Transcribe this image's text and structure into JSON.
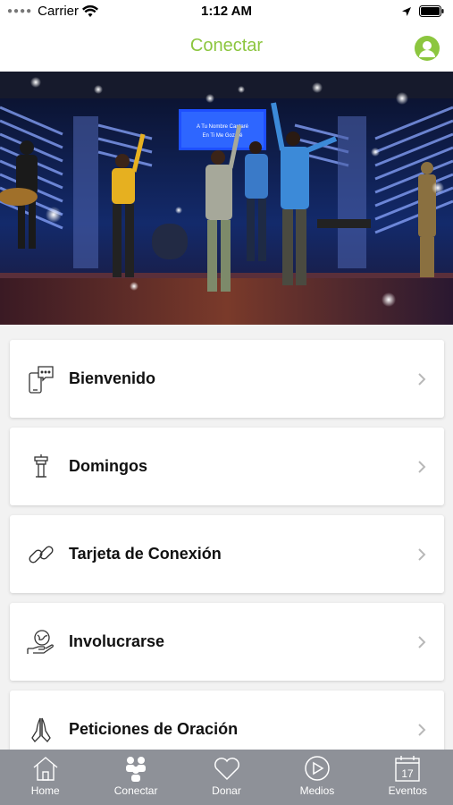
{
  "status": {
    "carrier": "Carrier",
    "time": "1:12 AM"
  },
  "nav": {
    "title": "Conectar"
  },
  "hero": {
    "banner_line1": "A Tu Nombre Cantaré",
    "banner_line2": "En Ti Me Gozaré"
  },
  "menu": [
    {
      "label": "Bienvenido",
      "icon": "phone-chat-icon"
    },
    {
      "label": "Domingos",
      "icon": "podium-icon"
    },
    {
      "label": "Tarjeta de Conexión",
      "icon": "link-icon"
    },
    {
      "label": "Involucrarse",
      "icon": "hand-globe-icon"
    },
    {
      "label": "Peticiones de Oración",
      "icon": "praying-hands-icon"
    }
  ],
  "tabs": [
    {
      "label": "Home",
      "icon": "home-icon"
    },
    {
      "label": "Conectar",
      "icon": "people-icon"
    },
    {
      "label": "Donar",
      "icon": "heart-icon"
    },
    {
      "label": "Medios",
      "icon": "play-icon"
    },
    {
      "label": "Eventos",
      "icon": "calendar-icon",
      "day": "17"
    }
  ],
  "colors": {
    "accent": "#8cc63f",
    "tab_bar": "#8e9198",
    "background": "#f2f2f2"
  }
}
